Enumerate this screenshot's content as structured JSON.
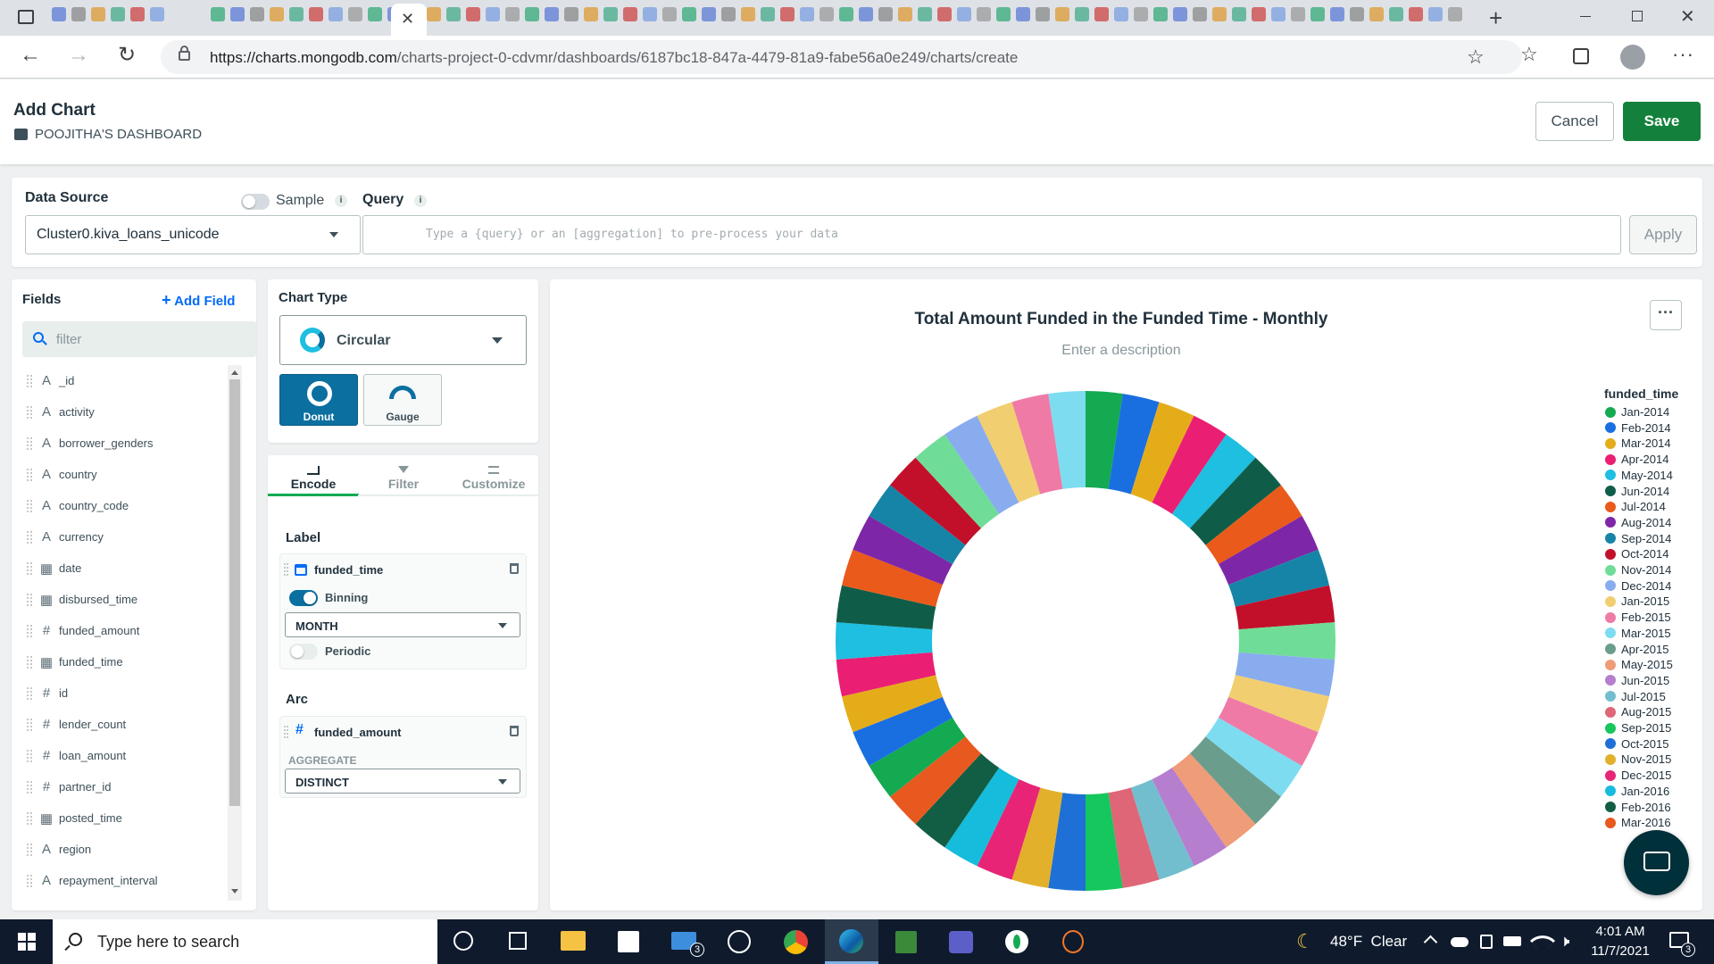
{
  "browser": {
    "url_host": "https://charts.mongodb.com",
    "url_path": "/charts-project-0-cdvmr/dashboards/6187bc18-847a-4479-81a9-fabe56a0e249/charts/create"
  },
  "header": {
    "title": "Add Chart",
    "dashboard": "POOJITHA'S DASHBOARD",
    "cancel_label": "Cancel",
    "save_label": "Save",
    "save_color": "#13813b"
  },
  "datasource": {
    "label": "Data Source",
    "value": "Cluster0.kiva_loans_unicode",
    "sample_label": "Sample",
    "query_label": "Query",
    "query_placeholder": "Type a {query} or an [aggregation] to pre-process your data",
    "apply_label": "Apply"
  },
  "fields": {
    "title": "Fields",
    "add_label": "Add Field",
    "filter_placeholder": "filter",
    "items": [
      {
        "name": "_id",
        "type": "string"
      },
      {
        "name": "activity",
        "type": "string"
      },
      {
        "name": "borrower_genders",
        "type": "string"
      },
      {
        "name": "country",
        "type": "string"
      },
      {
        "name": "country_code",
        "type": "string"
      },
      {
        "name": "currency",
        "type": "string"
      },
      {
        "name": "date",
        "type": "date"
      },
      {
        "name": "disbursed_time",
        "type": "date"
      },
      {
        "name": "funded_amount",
        "type": "number"
      },
      {
        "name": "funded_time",
        "type": "date"
      },
      {
        "name": "id",
        "type": "number"
      },
      {
        "name": "lender_count",
        "type": "number"
      },
      {
        "name": "loan_amount",
        "type": "number"
      },
      {
        "name": "partner_id",
        "type": "number"
      },
      {
        "name": "posted_time",
        "type": "date"
      },
      {
        "name": "region",
        "type": "string"
      },
      {
        "name": "repayment_interval",
        "type": "string"
      }
    ]
  },
  "charttype": {
    "label": "Chart Type",
    "selected": "Circular",
    "options": [
      "Donut",
      "Gauge"
    ]
  },
  "encode": {
    "tabs": [
      "Encode",
      "Filter",
      "Customize"
    ],
    "label_section": "Label",
    "label_field": "funded_time",
    "binning_label": "Binning",
    "binning_value": "MONTH",
    "periodic_label": "Periodic",
    "arc_section": "Arc",
    "arc_field": "funded_amount",
    "aggregate_label": "AGGREGATE",
    "aggregate_value": "DISTINCT"
  },
  "chart_data": {
    "type": "pie",
    "title": "Total Amount Funded in the Funded Time - Monthly",
    "subtitle": "Enter a description",
    "legend_title": "funded_time",
    "legend_placement": "right",
    "categories": [
      "Jan-2014",
      "Feb-2014",
      "Mar-2014",
      "Apr-2014",
      "May-2014",
      "Jun-2014",
      "Jul-2014",
      "Aug-2014",
      "Sep-2014",
      "Oct-2014",
      "Nov-2014",
      "Dec-2014",
      "Jan-2015",
      "Feb-2015",
      "Mar-2015",
      "Apr-2015",
      "May-2015",
      "Jun-2015",
      "Jul-2015",
      "Aug-2015",
      "Sep-2015",
      "Oct-2015",
      "Nov-2015",
      "Dec-2015",
      "Jan-2016",
      "Feb-2016",
      "Mar-2016"
    ],
    "colors": [
      "#13aa52",
      "#1a6fe0",
      "#e5ac1a",
      "#ea1e73",
      "#1ebfe0",
      "#0f5d48",
      "#ea5a1a",
      "#7e26a8",
      "#1684a6",
      "#c3102a",
      "#6fdd97",
      "#89acef",
      "#f1ce70",
      "#ef7aa6",
      "#7ddcf0",
      "#6b9d8d",
      "#ef9c78",
      "#b67ece",
      "#73bece",
      "#df6676",
      "#15c75c",
      "#1f70d6",
      "#e2b02b",
      "#e82476",
      "#16bcdb",
      "#115e44",
      "#e8591f"
    ],
    "slice_count": 42
  },
  "taskbar": {
    "search_placeholder": "Type here to search",
    "weather": "48°F  Clear",
    "time": "4:01 AM",
    "date": "11/7/2021",
    "mail_badge": "3",
    "notif_badge": "3"
  }
}
